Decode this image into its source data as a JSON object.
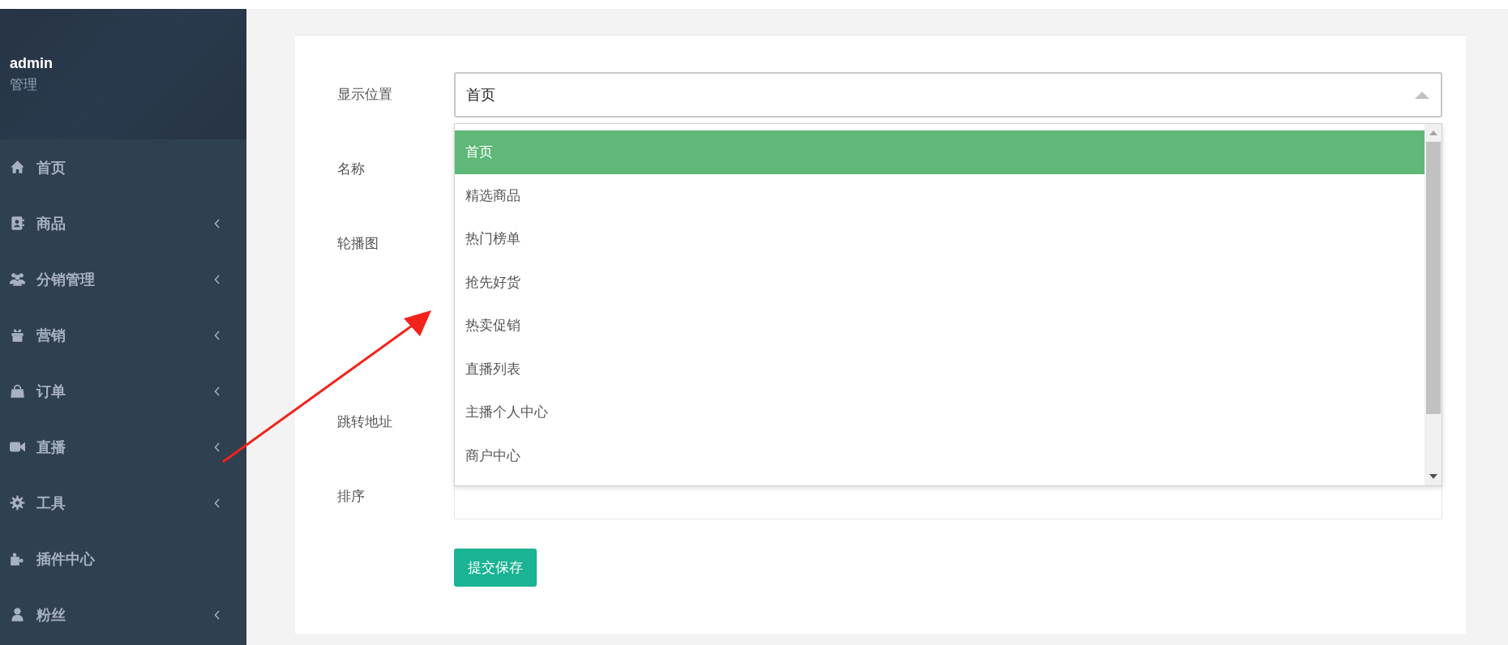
{
  "sidebar": {
    "user": {
      "name": "admin",
      "role": "管理"
    },
    "items": [
      {
        "label": "首页",
        "expandable": false
      },
      {
        "label": "商品",
        "expandable": true
      },
      {
        "label": "分销管理",
        "expandable": true
      },
      {
        "label": "营销",
        "expandable": true
      },
      {
        "label": "订单",
        "expandable": true
      },
      {
        "label": "直播",
        "expandable": true
      },
      {
        "label": "工具",
        "expandable": true
      },
      {
        "label": "插件中心",
        "expandable": false
      },
      {
        "label": "粉丝",
        "expandable": true
      }
    ]
  },
  "form": {
    "fields": [
      {
        "label": "显示位置"
      },
      {
        "label": "名称"
      },
      {
        "label": "轮播图"
      },
      {
        "label": "跳转地址"
      },
      {
        "label": "排序"
      }
    ],
    "select": {
      "value": "首页",
      "expanded": true,
      "options": [
        {
          "label": "首页",
          "selected": true
        },
        {
          "label": "精选商品",
          "selected": false
        },
        {
          "label": "热门榜单",
          "selected": false
        },
        {
          "label": "抢先好货",
          "selected": false
        },
        {
          "label": "热卖促销",
          "selected": false
        },
        {
          "label": "直播列表",
          "selected": false
        },
        {
          "label": "主播个人中心",
          "selected": false
        },
        {
          "label": "商户中心",
          "selected": false
        }
      ]
    },
    "submit": "提交保存"
  }
}
